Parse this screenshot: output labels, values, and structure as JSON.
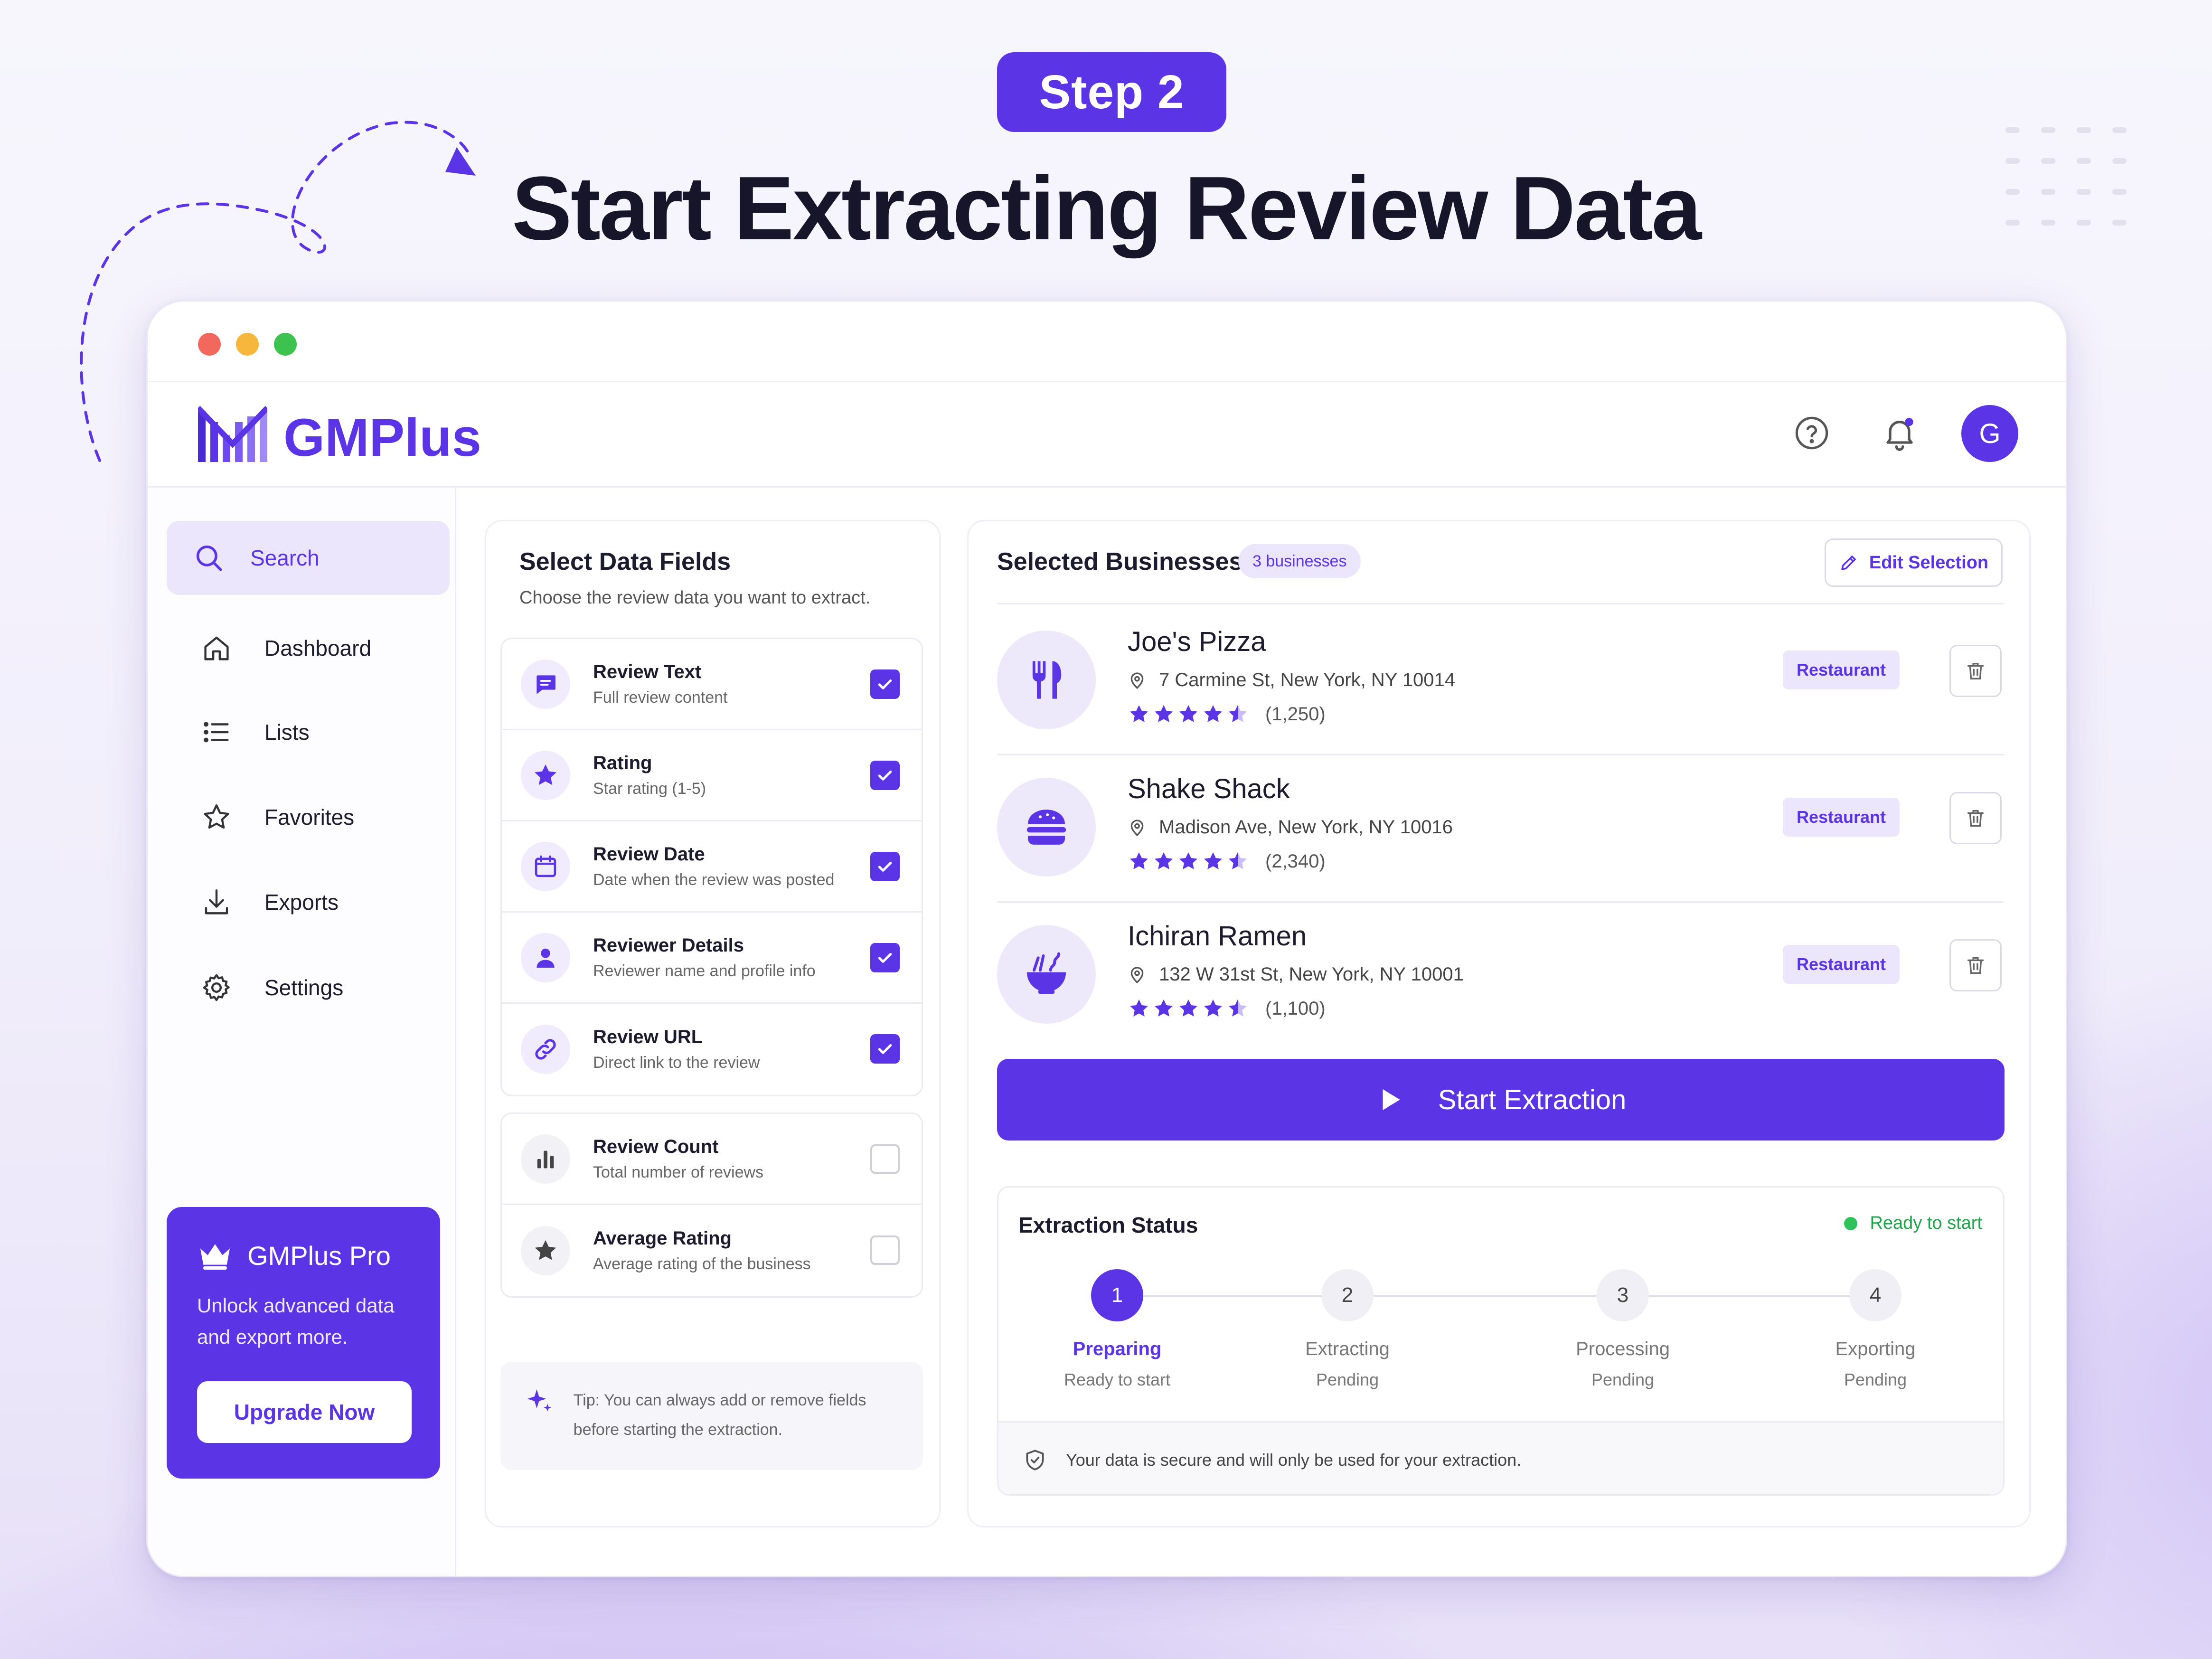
{
  "hero": {
    "step_label": "Step 2",
    "title": "Start Extracting Review Data"
  },
  "app": {
    "name": "GMPlus",
    "avatar_initial": "G",
    "accent_color": "#5b34e6"
  },
  "sidebar": {
    "search_label": "Search",
    "items": [
      {
        "label": "Dashboard",
        "icon": "home-icon"
      },
      {
        "label": "Lists",
        "icon": "list-icon"
      },
      {
        "label": "Favorites",
        "icon": "star-outline-icon"
      },
      {
        "label": "Exports",
        "icon": "download-icon"
      },
      {
        "label": "Settings",
        "icon": "gear-icon"
      }
    ],
    "pro": {
      "title": "GMPlus Pro",
      "description": "Unlock advanced data and export more.",
      "button": "Upgrade Now"
    }
  },
  "fields": {
    "title": "Select Data Fields",
    "subtitle": "Choose the review data you want to extract.",
    "selected": [
      {
        "label": "Review Text",
        "desc": "Full review content",
        "checked": true,
        "icon": "comment-icon"
      },
      {
        "label": "Rating",
        "desc": "Star rating (1-5)",
        "checked": true,
        "icon": "star-icon"
      },
      {
        "label": "Review Date",
        "desc": "Date when the review was posted",
        "checked": true,
        "icon": "calendar-icon"
      },
      {
        "label": "Reviewer Details",
        "desc": "Reviewer name and profile info",
        "checked": true,
        "icon": "person-icon"
      },
      {
        "label": "Review URL",
        "desc": "Direct link to the review",
        "checked": true,
        "icon": "link-icon"
      }
    ],
    "optional": [
      {
        "label": "Review Count",
        "desc": "Total number of reviews",
        "checked": false,
        "icon": "bar-chart-icon"
      },
      {
        "label": "Average Rating",
        "desc": "Average rating of the business",
        "checked": false,
        "icon": "star-icon"
      }
    ],
    "tip": "Tip: You can always add or remove fields before starting the extraction."
  },
  "businesses": {
    "title": "Selected Businesses",
    "count_badge": "3 businesses",
    "edit_label": "Edit Selection",
    "items": [
      {
        "name": "Joe's Pizza",
        "address": "7 Carmine St, New York, NY 10014",
        "rating": 4.5,
        "reviews": "(1,250)",
        "tag": "Restaurant",
        "icon": "utensils-icon"
      },
      {
        "name": "Shake Shack",
        "address": "Madison Ave, New York, NY 10016",
        "rating": 4.5,
        "reviews": "(2,340)",
        "tag": "Restaurant",
        "icon": "burger-icon"
      },
      {
        "name": "Ichiran Ramen",
        "address": "132 W 31st St, New York, NY 10001",
        "rating": 4.5,
        "reviews": "(1,100)",
        "tag": "Restaurant",
        "icon": "ramen-bowl-icon"
      }
    ],
    "start_button": "Start Extraction"
  },
  "status": {
    "title": "Extraction Status",
    "badge": "Ready to start",
    "steps": [
      {
        "num": "1",
        "name": "Preparing",
        "state": "Ready to start",
        "active": true
      },
      {
        "num": "2",
        "name": "Extracting",
        "state": "Pending",
        "active": false
      },
      {
        "num": "3",
        "name": "Processing",
        "state": "Pending",
        "active": false
      },
      {
        "num": "4",
        "name": "Exporting",
        "state": "Pending",
        "active": false
      }
    ],
    "footer": "Your data is secure and will only be used for your extraction."
  }
}
